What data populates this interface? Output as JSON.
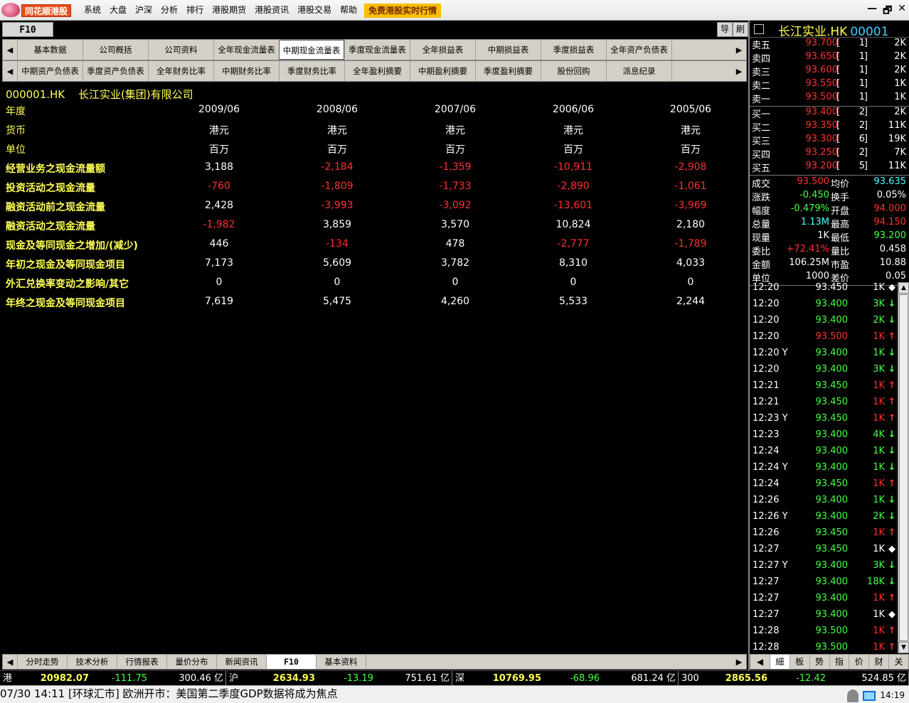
{
  "menubar": {
    "brand": "同花顺港股",
    "items": [
      "系统",
      "大盘",
      "沪深",
      "分析",
      "排行",
      "港股期货",
      "港股资讯",
      "港股交易",
      "帮助"
    ],
    "promo": "免费港股实时行情",
    "controls": [
      "—",
      "🗗",
      "✕"
    ]
  },
  "f10bar": {
    "label": "F10",
    "buttons": [
      "导",
      "刷"
    ]
  },
  "tabs_row1": [
    "基本数据",
    "公司概括",
    "公司资料",
    "全年现金流量表",
    "中期现金流量表",
    "季度现金流量表",
    "全年损益表",
    "中期损益表",
    "季度损益表",
    "全年资产负债表"
  ],
  "tabs_row1_active": 4,
  "tabs_row2": [
    "中期资产负债表",
    "季度资产负债表",
    "全年财务比率",
    "中期财务比率",
    "季度财务比率",
    "全年盈利摘要",
    "中期盈利摘要",
    "季度盈利摘要",
    "股份回购",
    "派息纪录"
  ],
  "company": {
    "code": "000001.HK",
    "name": "长江实业(集团)有限公司"
  },
  "table": {
    "header_rows": [
      {
        "label": "年度",
        "values": [
          "2009/06",
          "2008/06",
          "2007/06",
          "2006/06",
          "2005/06"
        ]
      },
      {
        "label": "货币",
        "values": [
          "港元",
          "港元",
          "港元",
          "港元",
          "港元"
        ]
      },
      {
        "label": "单位",
        "values": [
          "百万",
          "百万",
          "百万",
          "百万",
          "百万"
        ]
      }
    ],
    "data_rows": [
      {
        "label": "经营业务之现金流量额",
        "values": [
          "3,188",
          "-2,184",
          "-1,359",
          "-10,911",
          "-2,908"
        ]
      },
      {
        "label": "投资活动之现金流量",
        "values": [
          "-760",
          "-1,809",
          "-1,733",
          "-2,890",
          "-1,061"
        ]
      },
      {
        "label": "融资活动前之现金流量",
        "values": [
          "2,428",
          "-3,993",
          "-3,092",
          "-13,601",
          "-3,969"
        ]
      },
      {
        "label": "融资活动之现金流量",
        "values": [
          "-1,982",
          "3,859",
          "3,570",
          "10,824",
          "2,180"
        ]
      },
      {
        "label": "现金及等同现金之增加/(减少)",
        "values": [
          "446",
          "-134",
          "478",
          "-2,777",
          "-1,789"
        ]
      },
      {
        "label": "年初之现金及等同现金项目",
        "values": [
          "7,173",
          "5,609",
          "3,782",
          "8,310",
          "4,033"
        ]
      },
      {
        "label": "外汇兑换率变动之影响/其它",
        "values": [
          "0",
          "0",
          "0",
          "0",
          "0"
        ]
      },
      {
        "label": "年终之现金及等同现金项目",
        "values": [
          "7,619",
          "5,475",
          "4,260",
          "5,533",
          "2,244"
        ]
      }
    ]
  },
  "bottom_tabs": [
    "分时走势",
    "技术分析",
    "行情报表",
    "量价分布",
    "新闻资讯",
    "F10",
    "基本资料"
  ],
  "bottom_tabs_active": 5,
  "index_bar": [
    {
      "name": "港",
      "value": "20982.07",
      "change": "-111.75",
      "amount": "300.46 亿"
    },
    {
      "name": "沪",
      "value": "2634.93",
      "change": "-13.19",
      "amount": "751.61 亿"
    },
    {
      "name": "深",
      "value": "10769.95",
      "change": "-68.96",
      "amount": "681.24 亿"
    },
    {
      "name": "300",
      "value": "2865.56",
      "change": "-12.42",
      "amount": "524.85 亿"
    }
  ],
  "news": {
    "text": "07/30 14:11 [环球汇市] 欧洲开市：美国第二季度GDP数据将成为焦点",
    "clock": "14:19"
  },
  "stock": {
    "name": "长江实业.HK",
    "code": "00001"
  },
  "orderbook": {
    "asks": [
      {
        "label": "卖五",
        "price": "93.700",
        "qty": "1",
        "amount": "2K"
      },
      {
        "label": "卖四",
        "price": "93.650",
        "qty": "1",
        "amount": "2K"
      },
      {
        "label": "卖三",
        "price": "93.600",
        "qty": "1",
        "amount": "2K"
      },
      {
        "label": "卖二",
        "price": "93.550",
        "qty": "1",
        "amount": "1K"
      },
      {
        "label": "卖一",
        "price": "93.500",
        "qty": "1",
        "amount": "1K"
      }
    ],
    "bids": [
      {
        "label": "买一",
        "price": "93.400",
        "qty": "2",
        "amount": "2K"
      },
      {
        "label": "买二",
        "price": "93.350",
        "qty": "2",
        "amount": "11K"
      },
      {
        "label": "买三",
        "price": "93.300",
        "qty": "6",
        "amount": "19K"
      },
      {
        "label": "买四",
        "price": "93.250",
        "qty": "2",
        "amount": "7K"
      },
      {
        "label": "买五",
        "price": "93.200",
        "qty": "5",
        "amount": "11K"
      }
    ]
  },
  "stats": [
    {
      "k1": "成交",
      "v1": "93.500",
      "c1": "cr",
      "k2": "均价",
      "v2": "93.635",
      "c2": "cy"
    },
    {
      "k1": "涨跌",
      "v1": "-0.450",
      "c1": "cg",
      "k2": "换手",
      "v2": "0.05%",
      "c2": "cw"
    },
    {
      "k1": "幅度",
      "v1": "-0.479%",
      "c1": "cg",
      "k2": "开盘",
      "v2": "94.000",
      "c2": "cr"
    },
    {
      "k1": "总量",
      "v1": "1.13M",
      "c1": "cy",
      "k2": "最高",
      "v2": "94.150",
      "c2": "cr"
    },
    {
      "k1": "现量",
      "v1": "1K",
      "c1": "cw",
      "k2": "最低",
      "v2": "93.200",
      "c2": "cg"
    },
    {
      "k1": "委比",
      "v1": "+72.41%",
      "c1": "cr",
      "k2": "量比",
      "v2": "0.458",
      "c2": "cw"
    },
    {
      "k1": "金额",
      "v1": "106.25M",
      "c1": "cw",
      "k2": "市盈",
      "v2": "10.88",
      "c2": "cw"
    },
    {
      "k1": "单位",
      "v1": "1000",
      "c1": "cw",
      "k2": "差价",
      "v2": "0.05",
      "c2": "cw"
    }
  ],
  "ticks": [
    {
      "time": "12:20",
      "price": "93.450",
      "vol": "1K",
      "dir": "neu",
      "pc": "eq"
    },
    {
      "time": "12:20",
      "price": "93.400",
      "vol": "3K",
      "dir": "sell",
      "pc": "dn"
    },
    {
      "time": "12:20",
      "price": "93.400",
      "vol": "2K",
      "dir": "sell",
      "pc": "dn"
    },
    {
      "time": "12:20",
      "price": "93.500",
      "vol": "1K",
      "dir": "buy",
      "pc": "up"
    },
    {
      "time": "12:20 Y",
      "price": "93.400",
      "vol": "1K",
      "dir": "sell",
      "pc": "dn"
    },
    {
      "time": "12:20",
      "price": "93.400",
      "vol": "3K",
      "dir": "sell",
      "pc": "dn"
    },
    {
      "time": "12:21",
      "price": "93.450",
      "vol": "1K",
      "dir": "buy",
      "pc": "dn"
    },
    {
      "time": "12:21",
      "price": "93.450",
      "vol": "1K",
      "dir": "buy",
      "pc": "dn"
    },
    {
      "time": "12:23 Y",
      "price": "93.450",
      "vol": "1K",
      "dir": "buy",
      "pc": "dn"
    },
    {
      "time": "12:23",
      "price": "93.400",
      "vol": "4K",
      "dir": "sell",
      "pc": "dn"
    },
    {
      "time": "12:24",
      "price": "93.400",
      "vol": "1K",
      "dir": "sell",
      "pc": "dn"
    },
    {
      "time": "12:24 Y",
      "price": "93.400",
      "vol": "1K",
      "dir": "sell",
      "pc": "dn"
    },
    {
      "time": "12:24",
      "price": "93.450",
      "vol": "1K",
      "dir": "buy",
      "pc": "dn"
    },
    {
      "time": "12:26",
      "price": "93.400",
      "vol": "1K",
      "dir": "sell",
      "pc": "dn"
    },
    {
      "time": "12:26 Y",
      "price": "93.400",
      "vol": "2K",
      "dir": "sell",
      "pc": "dn"
    },
    {
      "time": "12:26",
      "price": "93.450",
      "vol": "1K",
      "dir": "buy",
      "pc": "dn"
    },
    {
      "time": "12:27",
      "price": "93.450",
      "vol": "1K",
      "dir": "neu",
      "pc": "dn"
    },
    {
      "time": "12:27 Y",
      "price": "93.400",
      "vol": "3K",
      "dir": "sell",
      "pc": "dn"
    },
    {
      "time": "12:27",
      "price": "93.400",
      "vol": "18K",
      "dir": "sell",
      "pc": "dn"
    },
    {
      "time": "12:27",
      "price": "93.400",
      "vol": "1K",
      "dir": "buy",
      "pc": "dn"
    },
    {
      "time": "12:27",
      "price": "93.400",
      "vol": "1K",
      "dir": "neu",
      "pc": "dn"
    },
    {
      "time": "12:28",
      "price": "93.500",
      "vol": "1K",
      "dir": "buy",
      "pc": "dn"
    },
    {
      "time": "12:28",
      "price": "93.500",
      "vol": "1K",
      "dir": "buy",
      "pc": "dn"
    }
  ],
  "right_tabs": [
    "細",
    "板",
    "势",
    "指",
    "价",
    "财",
    "关"
  ],
  "right_tabs_active": 0,
  "colors": {
    "positive": "#ffffff",
    "negative": "#ff3030",
    "label": "#ffff55",
    "buy": "#ff3030",
    "sell": "#44ff44"
  }
}
